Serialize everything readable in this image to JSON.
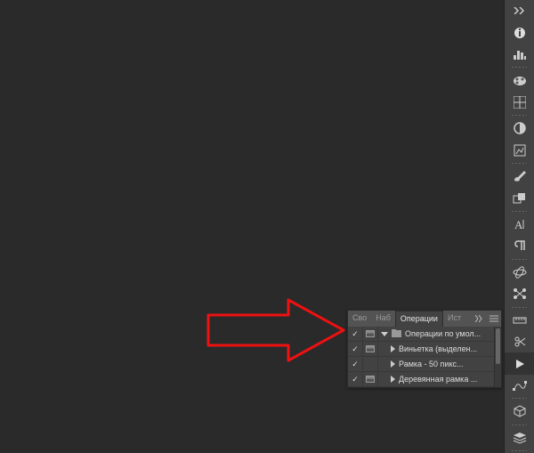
{
  "tabs": {
    "t1": "Сво",
    "t2": "Наб",
    "t3": "Операции",
    "t4": "Ист"
  },
  "actions": {
    "group": "Операции по умол...",
    "items": [
      "Виньетка (выделен...",
      "Рамка - 50 пикс...",
      "Деревянная рамка ..."
    ]
  },
  "toolbar_icons": [
    "panel-toggle",
    "info",
    "histogram",
    "sep",
    "swatches",
    "grid",
    "sep",
    "adjustments",
    "preset",
    "sep",
    "brush",
    "clone",
    "sep",
    "character",
    "paragraph",
    "sep",
    "3d",
    "node-graph",
    "sep",
    "measure",
    "scissors",
    "play",
    "path",
    "sep",
    "cube",
    "sep",
    "layers",
    "sep"
  ]
}
